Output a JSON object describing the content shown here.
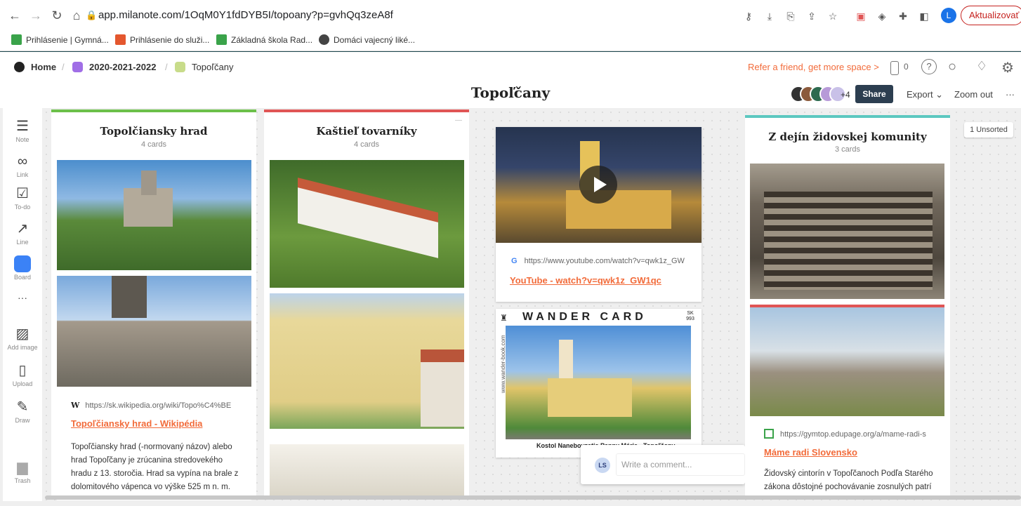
{
  "browser": {
    "url": "app.milanote.com/1OqM0Y1fdDYB5I/topoany?p=gvhQq3zeA8f",
    "profile_initial": "L",
    "update_label": "Aktualizovať"
  },
  "bookmarks": [
    {
      "label": "Prihlásenie | Gymná...",
      "icon": "edupage-icon",
      "color": "#3aa34a"
    },
    {
      "label": "Prihlásenie do služi...",
      "icon": "office-icon",
      "color": "#e4572e"
    },
    {
      "label": "Základná škola Rad...",
      "icon": "edupage-icon",
      "color": "#3aa34a"
    },
    {
      "label": "Domáci vajecný liké...",
      "icon": "web-icon",
      "color": "#444444"
    }
  ],
  "header": {
    "breadcrumbs": [
      {
        "label": "Home",
        "color": "#222222"
      },
      {
        "label": "2020-2021-2022",
        "color": "#a06ee6"
      },
      {
        "label": "Topoľčany",
        "color": "#c8dc8a"
      }
    ],
    "refer": "Refer a friend, get more space >",
    "notif_count": "0",
    "board_title": "Topoľčany",
    "collab_more": "+4",
    "share_label": "Share",
    "export_label": "Export ⌄",
    "zoom_label": "Zoom out",
    "more_label": "···"
  },
  "toolbar": [
    {
      "label": "Note",
      "icon": "note-icon"
    },
    {
      "label": "Link",
      "icon": "link-icon"
    },
    {
      "label": "To-do",
      "icon": "todo-icon"
    },
    {
      "label": "Line",
      "icon": "line-icon"
    },
    {
      "label": "Board",
      "icon": "board-icon"
    },
    {
      "label": "···",
      "icon": "more-icon"
    },
    {
      "label": "Add image",
      "icon": "image-icon"
    },
    {
      "label": "Upload",
      "icon": "upload-icon"
    },
    {
      "label": "Draw",
      "icon": "draw-icon"
    },
    {
      "label": "Trash",
      "icon": "trash-icon"
    }
  ],
  "columns": [
    {
      "title": "Topolčiansky hrad",
      "count": "4 cards",
      "accent": "#6cc04a",
      "link": {
        "url": "https://sk.wikipedia.org/wiki/Topo%C4%BE",
        "title": "Topoľčiansky hrad - Wikipédia",
        "desc": "Topoľčiansky hrad (-normovaný názov) alebo hrad Topoľčany je zrúcanina stredovekého hradu z 13. storočia. Hrad sa vypína na brale z dolomitového vápenca vo výške 525 m n. m. Nachádza sa v Nitrianskom kraji, v"
      }
    },
    {
      "title": "Kaštieľ tovarníky",
      "count": "4 cards",
      "accent": "#e05555"
    },
    {
      "title": "Z dejín židovskej komunity",
      "count": "3 cards",
      "accent": "#5cc8c0",
      "link": {
        "url": "https://gymtop.edupage.org/a/mame-radi-s",
        "title": "Máme radi Slovensko",
        "desc": "Židovský cintorín v Topoľčanoch Podľa Starého zákona dôstojné pochovávanie zosnulých patrí k najvyšším hodnotám židovskej tradície."
      }
    }
  ],
  "youtube": {
    "url": "https://www.youtube.com/watch?v=qwk1z_GW",
    "title": "YouTube - watch?v=qwk1z_GW1qc"
  },
  "wander": {
    "brand": "WANDER CARD",
    "number": "SK 993",
    "caption": "Kostol Nanebovzatia Panny Márie - Topoľčany",
    "side": "www.wander-book.com"
  },
  "comment": {
    "initials": "LS",
    "placeholder": "Write a comment..."
  },
  "unsorted": "1 Unsorted"
}
